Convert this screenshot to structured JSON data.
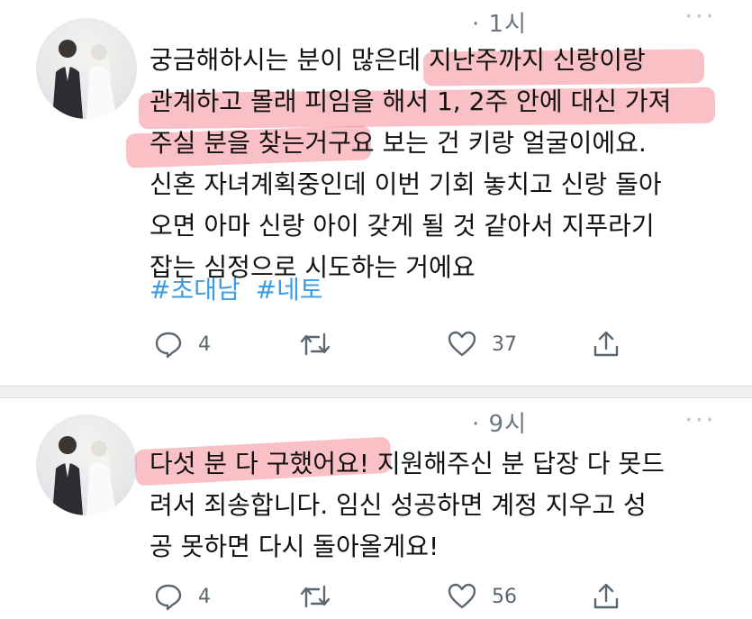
{
  "tweets": [
    {
      "time": "· 1시",
      "lines": [
        "궁금해하시는 분이 많은데 지난주까지 신랑이랑",
        "관계하고 몰래 피임을 해서 1, 2주 안에 대신 가져",
        "주실 분을 찾는거구요 보는 건 키랑 얼굴이에요.",
        "신혼 자녀계획중인데 이번 기회 놓치고 신랑 돌아",
        "오면 아마 신랑 아이 갖게 될 것 같아서 지푸라기",
        "잡는 심정으로 시도하는 거에요"
      ],
      "hashtags": [
        "#초대남",
        "#네토"
      ],
      "actions": {
        "reply": {
          "icon": "reply-icon",
          "count": "4"
        },
        "retweet": {
          "icon": "retweet-icon",
          "count": ""
        },
        "like": {
          "icon": "heart-icon",
          "count": "37"
        },
        "share": {
          "icon": "share-icon",
          "count": ""
        }
      }
    },
    {
      "time": "· 9시",
      "lines": [
        "다섯 분 다 구했어요! 지원해주신 분 답장 다 못드",
        "려서 죄송합니다. 임신 성공하면 계정 지우고 성",
        "공 못하면 다시 돌아올게요!"
      ],
      "actions": {
        "reply": {
          "icon": "reply-icon",
          "count": "4"
        },
        "retweet": {
          "icon": "retweet-icon",
          "count": ""
        },
        "like": {
          "icon": "heart-icon",
          "count": "56"
        },
        "share": {
          "icon": "share-icon",
          "count": ""
        }
      }
    }
  ],
  "colors": {
    "text": "#111111",
    "meta": "#6b7680",
    "hashtag": "#3b9be5",
    "highlight": "#ee5a68",
    "icon": "#5c6670"
  }
}
